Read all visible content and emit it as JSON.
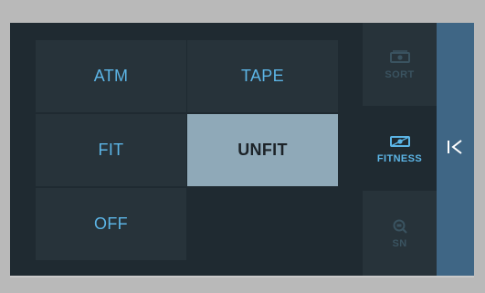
{
  "modes": [
    {
      "label": "ATM",
      "active": false
    },
    {
      "label": "TAPE",
      "active": false
    },
    {
      "label": "FIT",
      "active": false
    },
    {
      "label": "UNFIT",
      "active": true
    },
    {
      "label": "OFF",
      "active": false
    }
  ],
  "side_menu": {
    "sort": {
      "label": "SORT",
      "icon": "sort-banknote-icon"
    },
    "fitness": {
      "label": "FITNESS",
      "icon": "fitness-banknote-icon",
      "selected": true
    },
    "sn": {
      "label": "SN",
      "icon": "serial-number-search-icon"
    }
  },
  "collapse": {
    "icon": "collapse-panel-icon"
  },
  "colors": {
    "background": "#1f2a31",
    "button": "#27333a",
    "accent": "#5cb5e6",
    "active_button": "#8fa9b8",
    "side_bar": "#3f6685",
    "dim_text": "#3a5360"
  }
}
